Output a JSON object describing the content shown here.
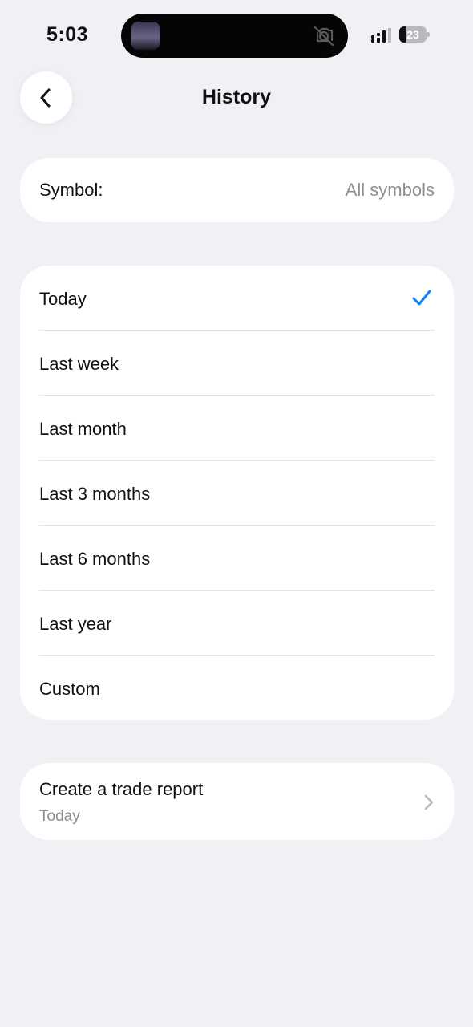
{
  "status_bar": {
    "time": "5:03",
    "battery_level": "23",
    "battery_fraction": 0.23
  },
  "header": {
    "title": "History",
    "back_icon": "chevron-left-icon"
  },
  "symbol_filter": {
    "label": "Symbol:",
    "value": "All symbols"
  },
  "periods": {
    "selected": "Today",
    "items": [
      {
        "label": "Today",
        "selected": true
      },
      {
        "label": "Last week",
        "selected": false
      },
      {
        "label": "Last month",
        "selected": false
      },
      {
        "label": "Last 3 months",
        "selected": false
      },
      {
        "label": "Last 6 months",
        "selected": false
      },
      {
        "label": "Last year",
        "selected": false
      },
      {
        "label": "Custom",
        "selected": false
      }
    ]
  },
  "trade_report": {
    "title": "Create a trade report",
    "subtitle": "Today",
    "icon": "chevron-right-icon"
  },
  "colors": {
    "background": "#f0f0f5",
    "card": "#ffffff",
    "accent_check": "#0a84ff",
    "secondary_text": "#8e8e93"
  }
}
